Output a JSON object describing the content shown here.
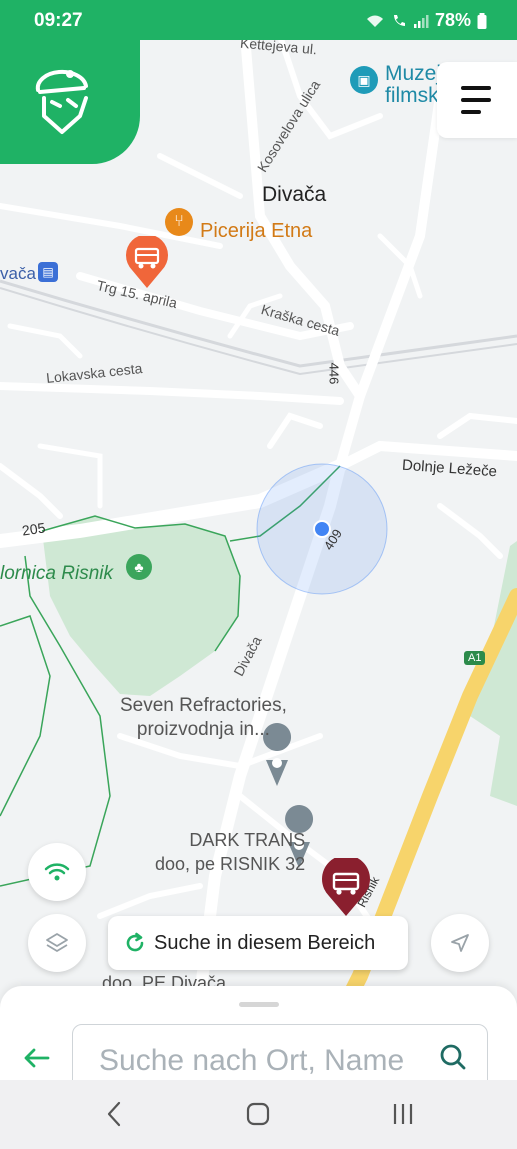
{
  "status_bar": {
    "time": "09:27",
    "battery": "78%"
  },
  "map": {
    "city_label": "Divača",
    "places": {
      "pizzeria": "Picerija Etna",
      "museum_line1": "Muzej",
      "museum_line2": "filmsk",
      "station": "vača",
      "refractories_line1": "Seven Refractories,",
      "refractories_line2": "proizvodnja in...",
      "dark_trans_line1": "DARK TRANS",
      "dark_trans_line2": "doo, pe RISNIK 32",
      "pe_divaca": "doo, PE Divača",
      "park": "lornica Risnik"
    },
    "streets": {
      "kettejeva": "Kettejeva ul.",
      "kosovelova": "Kosovelova ulica",
      "trg": "Trg 15. aprila",
      "kraska": "Kraška cesta",
      "lokavska": "Lokavska cesta",
      "dolnje": "Dolnje Ležeče",
      "divaca_road": "Divača",
      "risnik_road": "Risnik",
      "r205": "205",
      "r446": "446",
      "r409": "409",
      "a1": "A1"
    }
  },
  "controls": {
    "search_area_label": "Suche in diesem Bereich"
  },
  "bottom_sheet": {
    "search_placeholder": "Suche nach Ort, Name"
  },
  "colors": {
    "brand_green": "#1fb265",
    "marker_orange": "#f0663a",
    "marker_maroon": "#8a1f2e",
    "location_blue": "#4285f4",
    "highway_yellow": "#f7d46b"
  }
}
